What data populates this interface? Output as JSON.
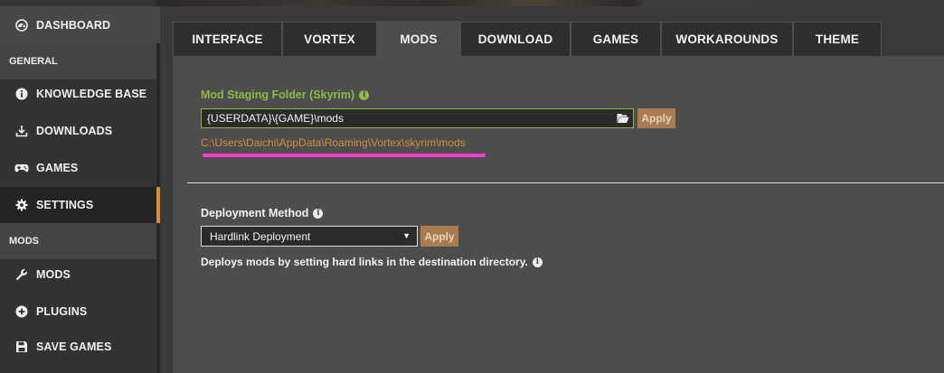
{
  "sidebar": {
    "items": [
      {
        "label": "DASHBOARD",
        "icon": "dashboard-icon"
      },
      {
        "section": "GENERAL"
      },
      {
        "label": "KNOWLEDGE BASE",
        "icon": "info-icon"
      },
      {
        "label": "DOWNLOADS",
        "icon": "download-icon"
      },
      {
        "label": "GAMES",
        "icon": "gamepad-icon"
      },
      {
        "label": "SETTINGS",
        "icon": "gear-icon",
        "active": true
      },
      {
        "section": "MODS"
      },
      {
        "label": "MODS",
        "icon": "wrench-icon"
      },
      {
        "label": "PLUGINS",
        "icon": "plus-circle-icon"
      },
      {
        "label": "SAVE GAMES",
        "icon": "floppy-icon"
      }
    ]
  },
  "tabs": [
    {
      "label": "INTERFACE"
    },
    {
      "label": "VORTEX"
    },
    {
      "label": "MODS",
      "active": true
    },
    {
      "label": "DOWNLOAD"
    },
    {
      "label": "GAMES"
    },
    {
      "label": "WORKAROUNDS"
    },
    {
      "label": "THEME"
    }
  ],
  "staging": {
    "label": "Mod Staging Folder (Skyrim)",
    "value": "{USERDATA}\\{GAME}\\mods",
    "apply_label": "Apply",
    "resolved_path": "C:\\Users\\Daichi\\AppData\\Roaming\\Vortex\\skyrim\\mods"
  },
  "deployment": {
    "label": "Deployment Method",
    "selected": "Hardlink Deployment",
    "apply_label": "Apply",
    "description": "Deploys mods by setting hard links in the destination directory."
  },
  "colors": {
    "accent_orange": "#d98b3a",
    "valid_green": "#8fb848",
    "highlight_magenta": "#ff3ccd",
    "apply_button": "#a97c4f"
  }
}
